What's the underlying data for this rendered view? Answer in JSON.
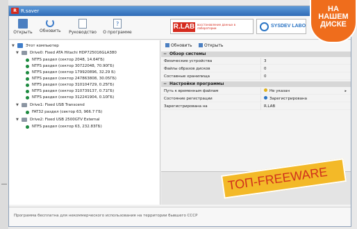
{
  "window": {
    "title": "R.saver",
    "app_icon_text": "R"
  },
  "toolbar": {
    "buttons": [
      {
        "label": "Открыть",
        "icon": "open-folder-icon"
      },
      {
        "label": "Обновить",
        "icon": "refresh-icon"
      },
      {
        "label": "Руководство",
        "icon": "manual-icon"
      },
      {
        "label": "О программе",
        "icon": "about-icon"
      }
    ],
    "banners": {
      "rlab_logo": "R.LAB",
      "rlab_tagline": "восстановление данных в лаборатории",
      "sysdev_name": "SYSDEV LABO"
    }
  },
  "tree": {
    "root": "Этот компьютер",
    "drives": [
      {
        "label": "Drive0: Fixed ATA Hitachi HDP725016GLA380",
        "partitions": [
          "NTFS раздел (сектор 2048, 14.64ГБ)",
          "NTFS раздел (сектор 30722048, 70.90ГБ)",
          "NTFS раздел (сектор 179920896, 32.29 Б)",
          "NTFS раздел (сектор 247863808, 30.05ГБ)",
          "NTFS раздел (сектор 310104729, 0.25ГБ)",
          "NTFS раздел (сектор 310739137, 0.71ГБ)",
          "NTFS раздел (сектор 312241904, 0.10ГБ)"
        ]
      },
      {
        "label": "Drive1: Fixed USB Transcend",
        "partitions": [
          "FAT32 раздел (сектор 63, 966.7 ГБ)"
        ]
      },
      {
        "label": "Drive2: Fixed USB 2500GTV External",
        "partitions": [
          "NTFS раздел (сектор 63, 232.83ГБ)"
        ]
      }
    ]
  },
  "right_toolbar": {
    "refresh": "Обновить",
    "open": "Открыть"
  },
  "properties": {
    "section1": "Обзор системы",
    "rows1": [
      {
        "key": "Физические устройства",
        "value": "3"
      },
      {
        "key": "Файлы образов дисков",
        "value": "0"
      },
      {
        "key": "Составные хранилища",
        "value": "0"
      }
    ],
    "section2": "Настройки программы",
    "rows2": [
      {
        "key": "Путь к временным файлам",
        "value": "Не указан",
        "dot_color": "#e0b21c"
      },
      {
        "key": "Состояние регистрации",
        "value": "Зарегистрирована",
        "dot_color": "#2a74c4"
      },
      {
        "key": "Зарегистрирована на",
        "value": "R.LAB"
      }
    ]
  },
  "status": {
    "text": "Программа бесплатна для некоммерческого использования на территории бывшего СССР"
  },
  "promo": {
    "disk": [
      "НА",
      "НАШЕМ",
      "ДИСКЕ"
    ],
    "freeware": "ТОП-FREEWARE"
  },
  "colors": {
    "accent": "#2f6bb7",
    "brand_red": "#d52b1e",
    "promo_orange": "#ef6d1c",
    "promo_yellow": "#f3b928"
  }
}
